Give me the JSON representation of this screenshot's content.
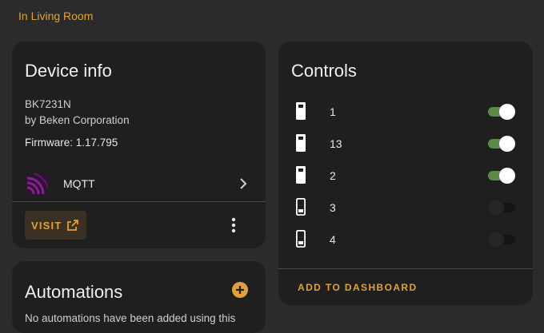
{
  "area": {
    "link_text": "In Living Room"
  },
  "device_info": {
    "title": "Device info",
    "model": "BK7231N",
    "manufacturer": "by Beken Corporation",
    "firmware": "Firmware: 1.17.795",
    "integration": {
      "label": "MQTT",
      "icon": "mqtt-icon"
    },
    "visit_label": "VISIT",
    "menu_icon": "more-vert-icon"
  },
  "controls": {
    "title": "Controls",
    "items": [
      {
        "name": "1",
        "state": "on",
        "icon": "switch-on-icon"
      },
      {
        "name": "13",
        "state": "on",
        "icon": "switch-on-icon"
      },
      {
        "name": "2",
        "state": "on",
        "icon": "switch-on-icon"
      },
      {
        "name": "3",
        "state": "off",
        "icon": "switch-off-icon"
      },
      {
        "name": "4",
        "state": "off",
        "icon": "switch-off-icon"
      }
    ],
    "add_to_dashboard_label": "ADD TO DASHBOARD"
  },
  "automations": {
    "title": "Automations",
    "text": "No automations have been added using this"
  },
  "colors": {
    "accent": "#e0a238",
    "toggle_on": "#5b8a4a",
    "card_bg": "#1f1f1f",
    "page_bg": "#2b2b2b"
  }
}
